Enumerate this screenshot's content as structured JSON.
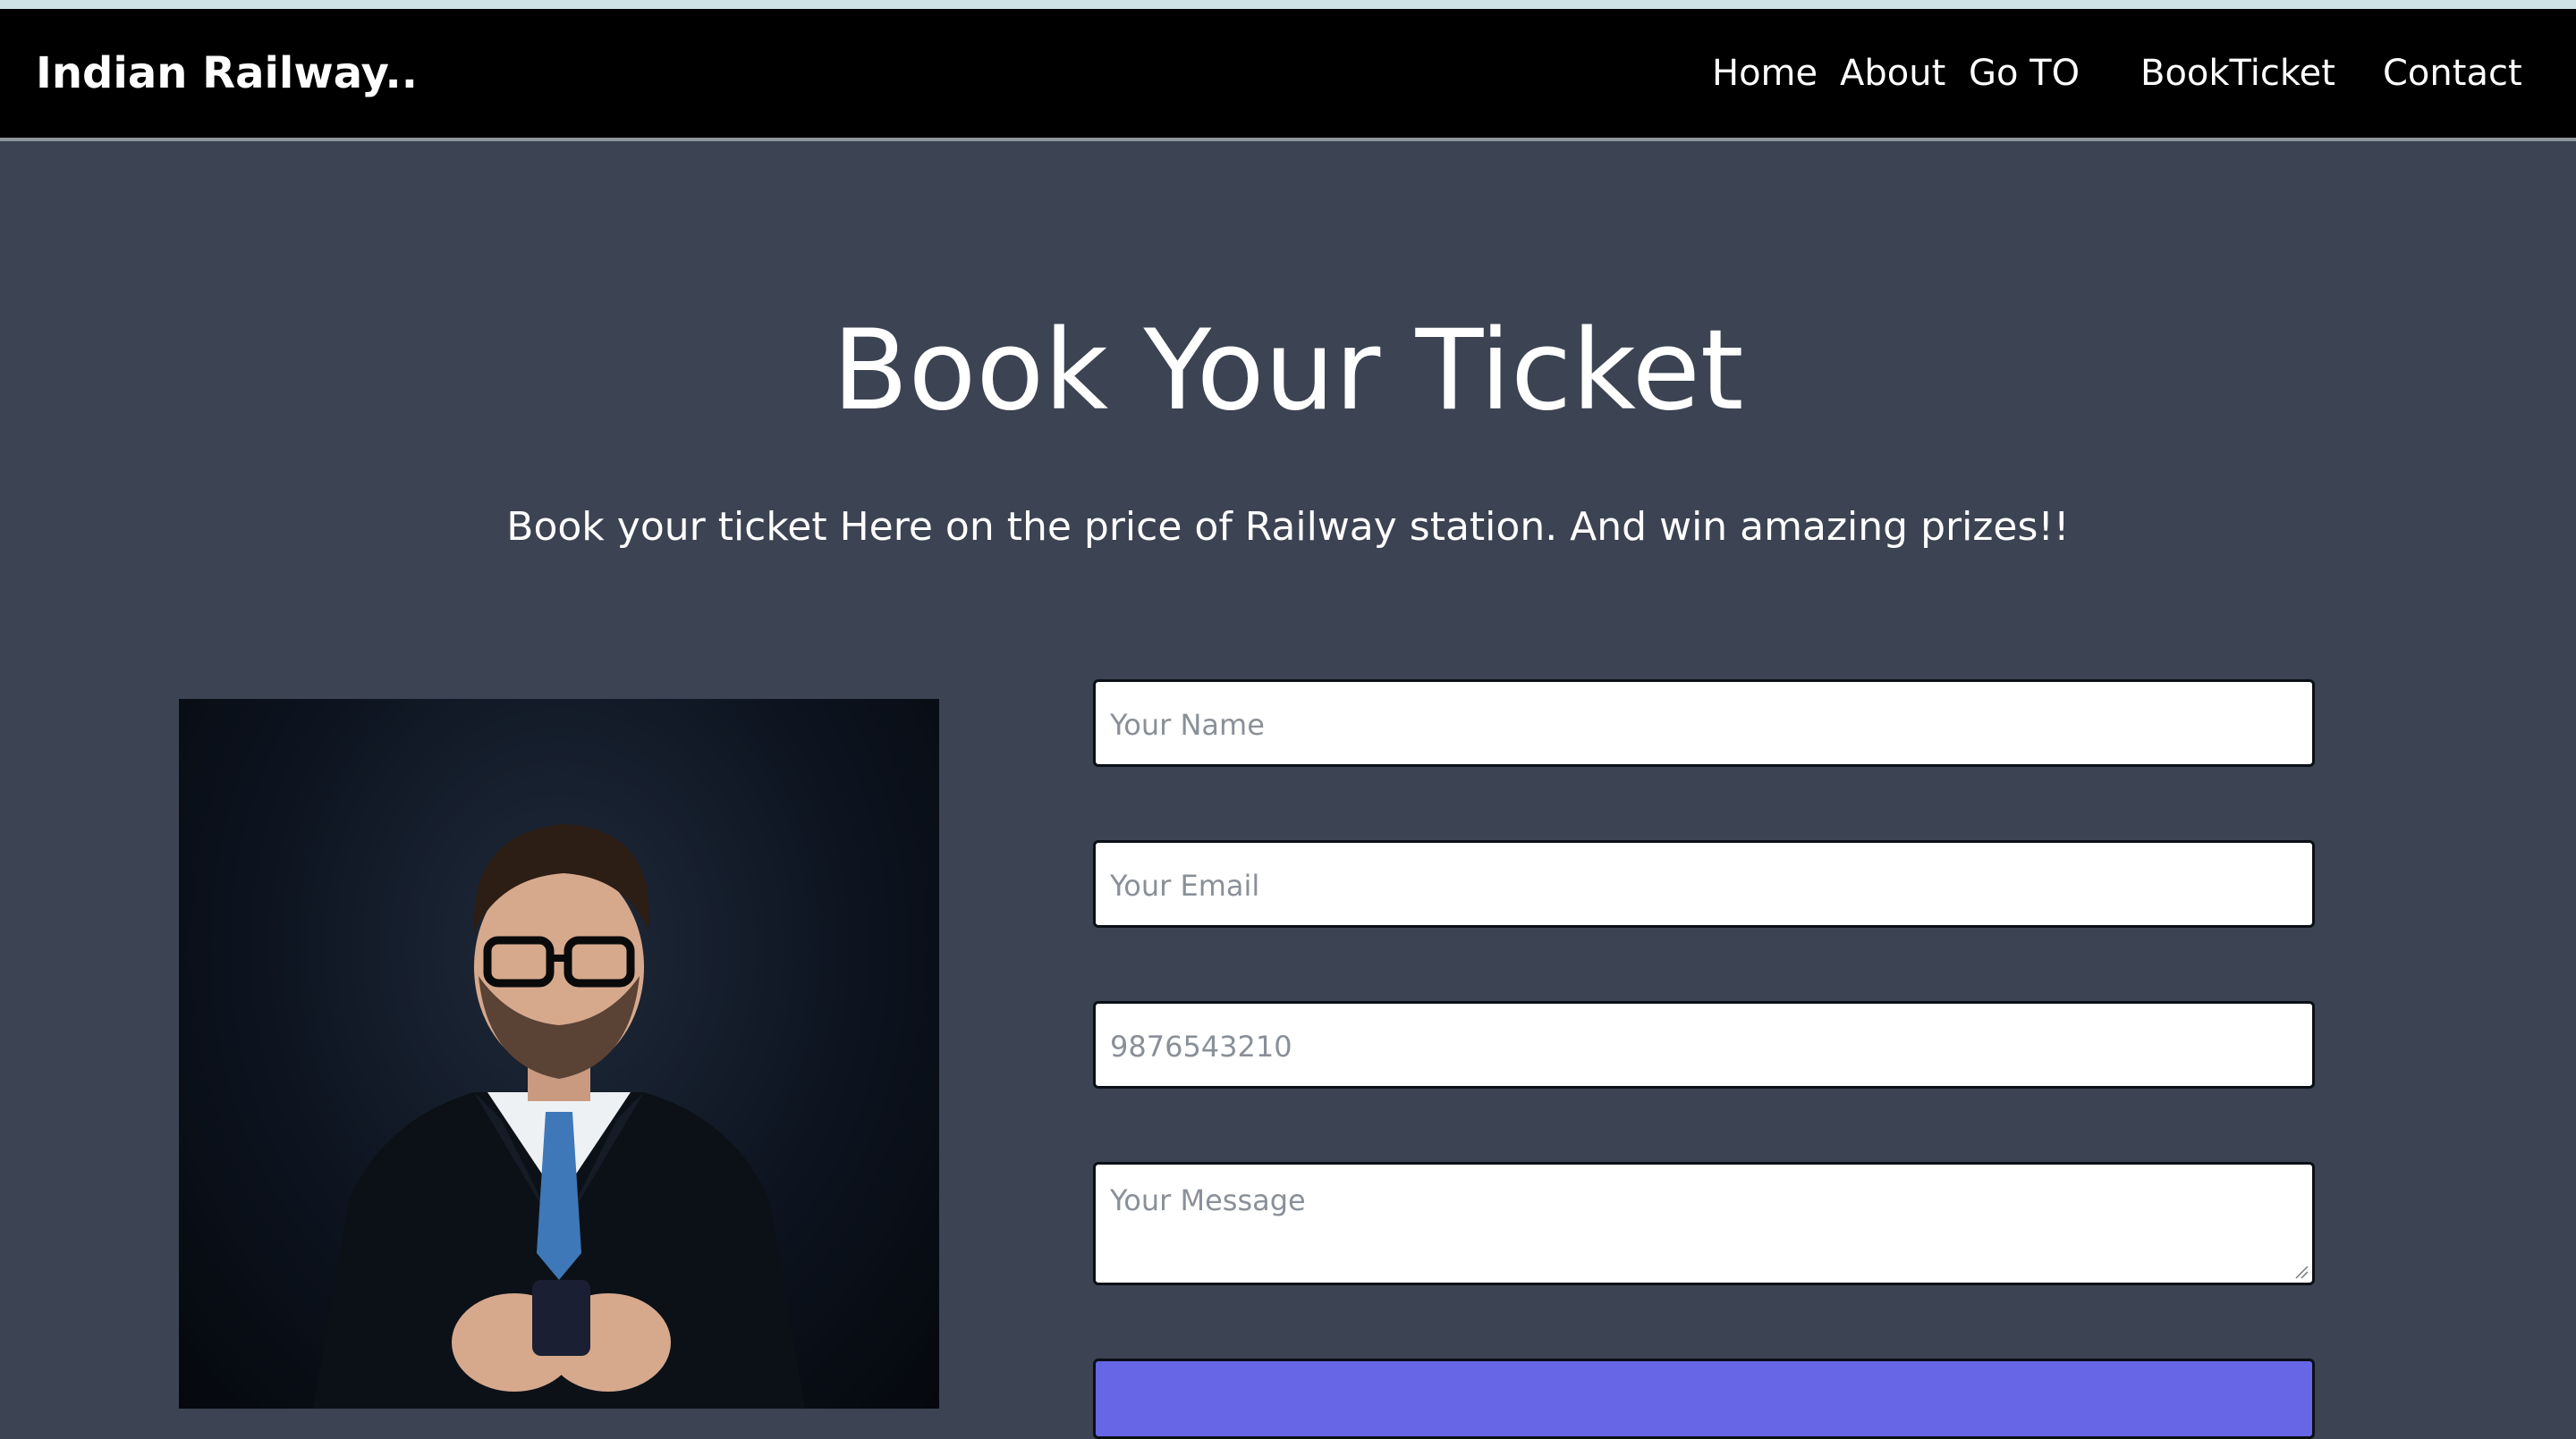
{
  "header": {
    "brand": "Indian Railway..",
    "nav": [
      {
        "label": "Home"
      },
      {
        "label": "About"
      },
      {
        "label": "Go TO"
      },
      {
        "label": "BookTicket"
      },
      {
        "label": "Contact"
      }
    ]
  },
  "hero": {
    "title": "Book Your Ticket",
    "subtitle": "Book your ticket Here on the price of Railway station. And win amazing prizes!!"
  },
  "form": {
    "name_placeholder": "Your Name",
    "email_placeholder": "Your Email",
    "phone_placeholder": "9876543210",
    "message_placeholder": "Your Message"
  },
  "colors": {
    "background": "#3c4352",
    "navbar": "#000000",
    "submit_button": "#6666e6"
  }
}
